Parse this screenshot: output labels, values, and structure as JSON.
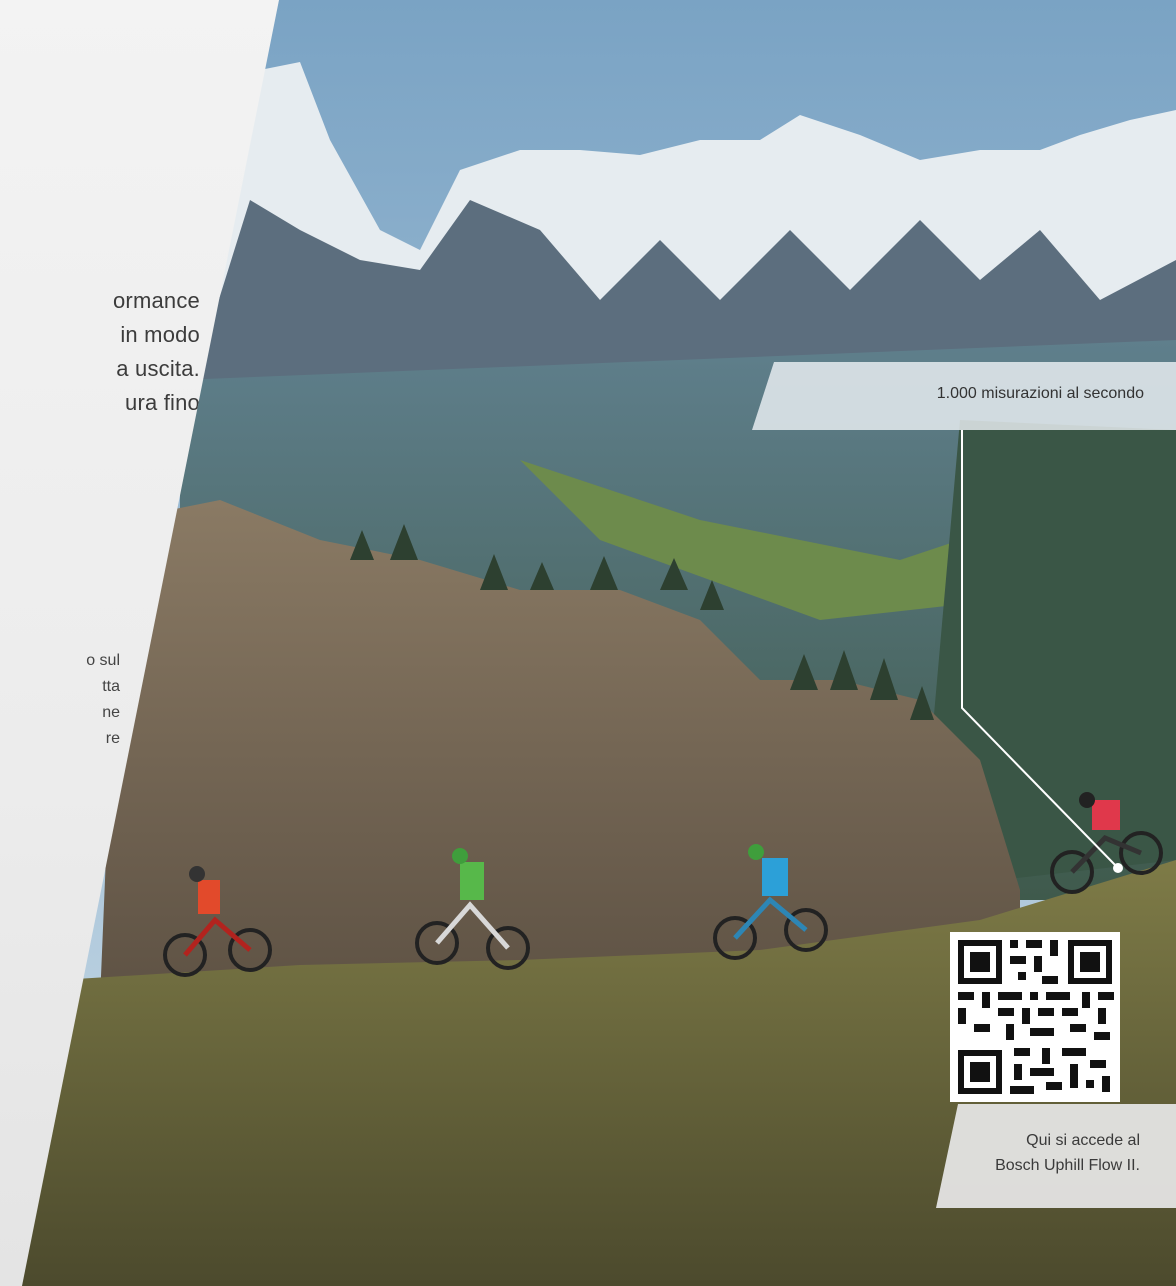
{
  "intro": {
    "lines": [
      "ormance",
      "in modo",
      "a uscita.",
      "ura fino"
    ]
  },
  "body": {
    "lines": [
      "o sul",
      "tta",
      "ne",
      "re"
    ]
  },
  "callout": {
    "label": "1.000 misurazioni al secondo"
  },
  "qr": {
    "caption_line1": "Qui si accede al",
    "caption_line2": "Bosch Uphill Flow II."
  },
  "colors": {
    "panel": "#efefef",
    "text": "#3c3c3c",
    "callout_bg": "#eef1f4",
    "leader_line": "#ffffff"
  }
}
